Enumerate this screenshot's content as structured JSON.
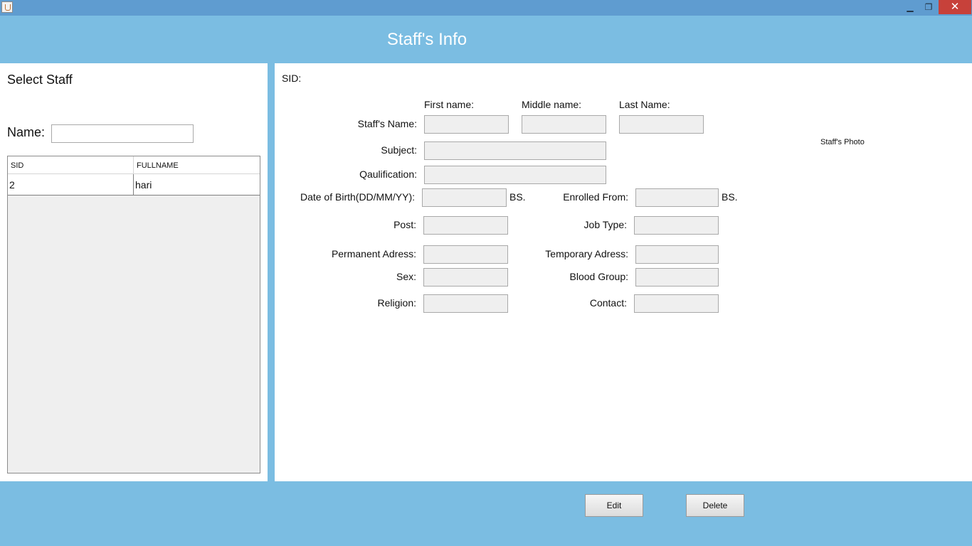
{
  "window": {
    "minimize_glyph": "▁",
    "maximize_glyph": "❐",
    "close_glyph": "✕"
  },
  "header": {
    "title": "Staff's Info"
  },
  "left": {
    "heading": "Select Staff",
    "name_label": "Name:",
    "name_value": "",
    "table": {
      "columns": [
        "SID",
        "FULLNAME"
      ],
      "rows": [
        {
          "sid": "2",
          "fullname": "hari"
        }
      ]
    }
  },
  "form": {
    "sid_label": "SID:",
    "first_name_header": "First name:",
    "middle_name_header": "Middle name:",
    "last_name_header": "Last Name:",
    "staff_name_label": "Staff's Name:",
    "subject_label": "Subject:",
    "qualification_label": "Qaulification:",
    "dob_label": "Date of Birth(DD/MM/YY):",
    "dob_suffix": "BS.",
    "enrolled_label": "Enrolled From:",
    "enrolled_suffix": "BS.",
    "post_label": "Post:",
    "job_type_label": "Job Type:",
    "permanent_label": "Permanent Adress:",
    "temporary_label": "Temporary Adress:",
    "sex_label": "Sex:",
    "blood_group_label": "Blood Group:",
    "religion_label": "Religion:",
    "contact_label": "Contact:",
    "photo_label": "Staff's Photo"
  },
  "buttons": {
    "edit": "Edit",
    "delete": "Delete"
  }
}
